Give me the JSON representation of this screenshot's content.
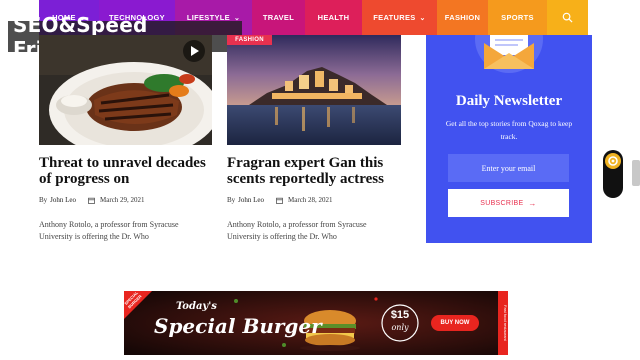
{
  "nav": {
    "items": [
      {
        "label": "HOME",
        "dropdown": true,
        "color": "#7c1fd6",
        "width": 60
      },
      {
        "label": "TECHNOLOGY",
        "dropdown": false,
        "color": "#8a1ad0",
        "width": 76
      },
      {
        "label": "LIFESTYLE",
        "dropdown": true,
        "color": "#a81aa8",
        "width": 77
      },
      {
        "label": "TRAVEL",
        "dropdown": false,
        "color": "#c8157a",
        "width": 53
      },
      {
        "label": "HEALTH",
        "dropdown": false,
        "color": "#dd1f5a",
        "width": 57
      },
      {
        "label": "FEATURES",
        "dropdown": true,
        "color": "#ee4a2f",
        "width": 75
      },
      {
        "label": "FASHION",
        "dropdown": false,
        "color": "#f37622",
        "width": 51
      },
      {
        "label": "SPORTS",
        "dropdown": false,
        "color": "#f59a1d",
        "width": 59
      }
    ],
    "search_color": "#f7b019",
    "search_icon": "search-icon"
  },
  "badge": {
    "text": "SEO&Speed Friendly"
  },
  "category_tag": "FASHION",
  "articles": [
    {
      "title": "Threat to unravel decades of progress on",
      "by": "By",
      "author": "John Leo",
      "date": "March 29, 2021",
      "excerpt": "Anthony Rotolo, a professor from Syracuse University is offering the Dr. Who"
    },
    {
      "title": "Fragran expert Gan this scents reportedly actress",
      "by": "By",
      "author": "John Leo",
      "date": "March 28, 2021",
      "excerpt": "Anthony Rotolo, a professor from Syracuse University is offering the Dr. Who"
    }
  ],
  "newsletter": {
    "title": "Daily Newsletter",
    "text": "Get all the top stories from Qoxag to keep track.",
    "email_placeholder": "Enter your email",
    "button_label": "SUBSCRIBE",
    "bg_color": "#4152f0"
  },
  "ad": {
    "corner": "SPECIAL\nBURGER",
    "headline_small": "Today's",
    "headline": "Special Burger",
    "price_top": "$15",
    "price_bottom": "only",
    "cta": "BUY NOW",
    "side_text": "Fast food restaurant"
  }
}
